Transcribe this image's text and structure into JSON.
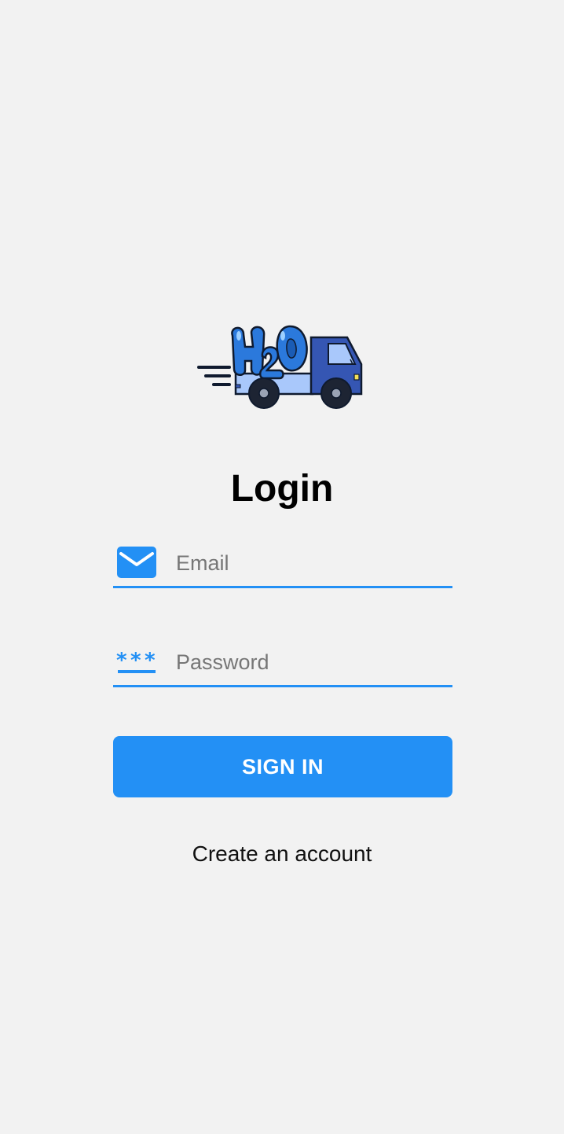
{
  "logo": {
    "icon": "delivery-truck-icon",
    "colors": {
      "truck_dark": "#3556b3",
      "truck_light": "#a9c8fb",
      "water_blue": "#2b79dc",
      "outline": "#0f1a2e"
    }
  },
  "login": {
    "title": "Login",
    "email_placeholder": "Email",
    "email_value": "",
    "password_placeholder": "Password",
    "password_value": "",
    "email_icon": "mail-icon",
    "password_icon": "password-icon",
    "signin_label": "SIGN IN",
    "create_account_label": "Create an account"
  },
  "colors": {
    "accent": "#2390f5",
    "background": "#f2f2f2"
  }
}
